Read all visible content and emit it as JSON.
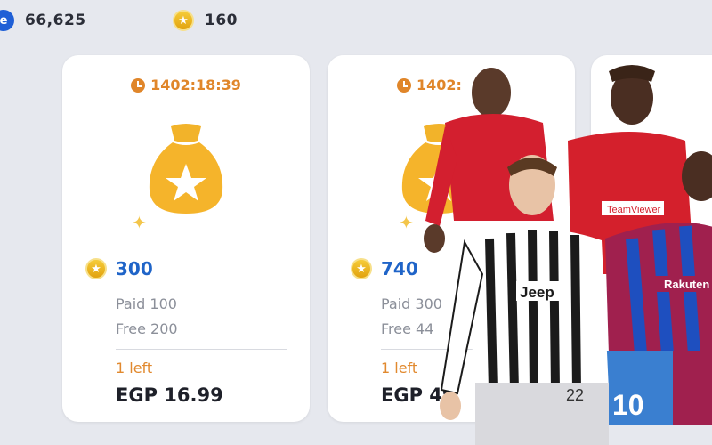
{
  "currencies": [
    {
      "icon": "efootball-coin-icon",
      "value": "66,625"
    },
    {
      "icon": "star-coin-icon",
      "value": "160"
    }
  ],
  "cards": [
    {
      "timer": "1402:18:39",
      "coins": "300",
      "paid": "Paid 100",
      "free": "Free 200",
      "left": "1 left",
      "price": "EGP 16.99"
    },
    {
      "timer": "1402:",
      "coins": "740",
      "paid": "Paid 300",
      "free": "Free 44",
      "left": "1 left",
      "price": "EGP 49"
    }
  ],
  "player_overlay": {
    "jersey_texts": {
      "juventus": "Jeep",
      "man_utd": "TeamViewer",
      "barca": "Rakuten",
      "number": "10",
      "juve_number": "22"
    }
  },
  "colors": {
    "accent_orange": "#e0862a",
    "coin_blue": "#1f64c8",
    "bg": "#e6e8ee"
  }
}
